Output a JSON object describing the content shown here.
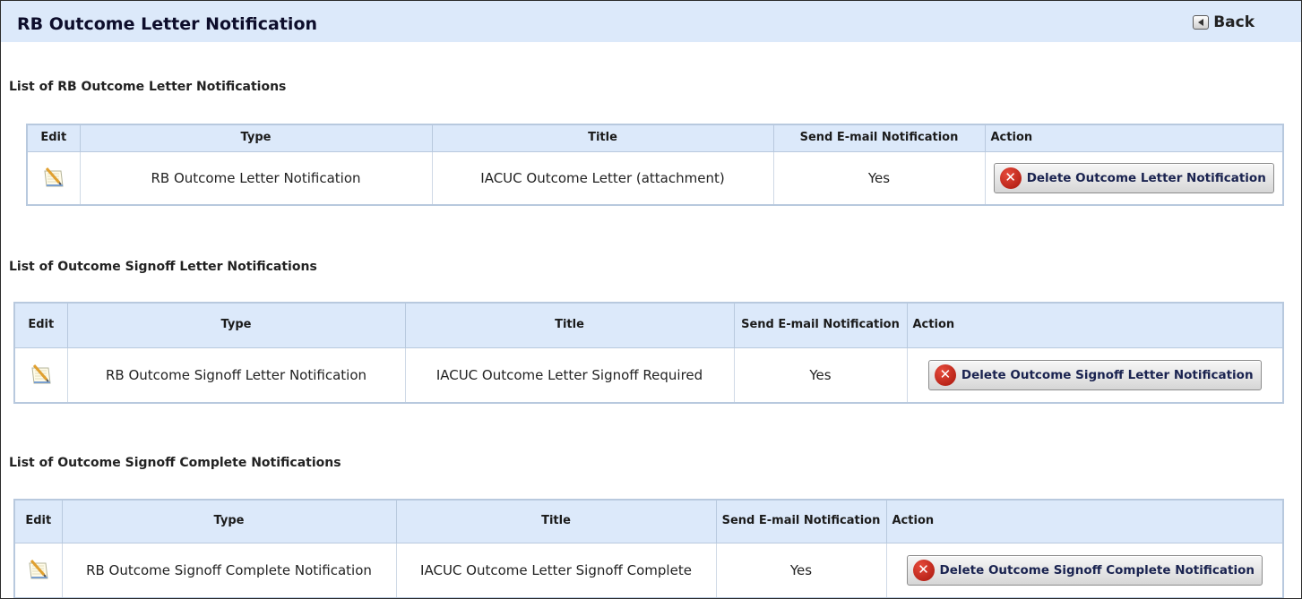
{
  "header": {
    "title": "RB Outcome Letter Notification",
    "back_label": "Back"
  },
  "columns": {
    "edit": "Edit",
    "type": "Type",
    "title": "Title",
    "send_email": "Send E-mail Notification",
    "action": "Action"
  },
  "sections": [
    {
      "heading": "List of RB Outcome Letter Notifications",
      "row": {
        "type": "RB Outcome Letter Notification",
        "title": "IACUC Outcome Letter (attachment)",
        "send_email": "Yes",
        "action_label": "Delete Outcome Letter Notification"
      }
    },
    {
      "heading": "List of Outcome Signoff Letter Notifications",
      "row": {
        "type": "RB Outcome Signoff Letter Notification",
        "title": "IACUC Outcome Letter Signoff Required",
        "send_email": "Yes",
        "action_label": "Delete Outcome Signoff Letter Notification"
      }
    },
    {
      "heading": "List of Outcome Signoff Complete Notifications",
      "row": {
        "type": "RB Outcome Signoff Complete Notification",
        "title": "IACUC Outcome Letter Signoff Complete",
        "send_email": "Yes",
        "action_label": "Delete Outcome Signoff Complete Notification"
      }
    }
  ],
  "icons": {
    "edit": "notepad-edit-icon",
    "delete": "red-x-circle-icon",
    "back": "left-arrow-icon"
  },
  "colors": {
    "header_bg": "#dce9fa",
    "table_border": "#b8c9de",
    "delete_icon": "#c8281b"
  }
}
